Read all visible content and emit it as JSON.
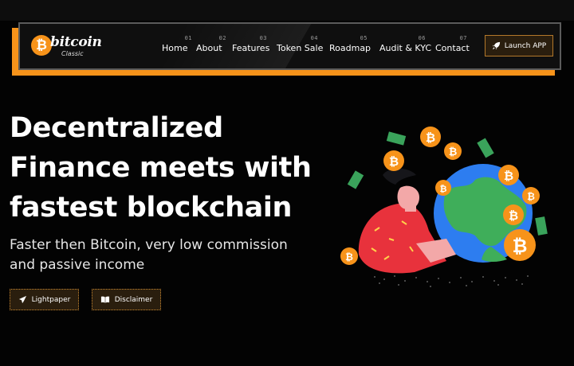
{
  "brand": {
    "name": "bitcoin",
    "sub": "Classic",
    "coin_symbol": "₿",
    "color": "#f7931a"
  },
  "nav": {
    "items": [
      {
        "num": "01",
        "label": "Home"
      },
      {
        "num": "02",
        "label": "About"
      },
      {
        "num": "03",
        "label": "Features"
      },
      {
        "num": "04",
        "label": "Token Sale"
      },
      {
        "num": "05",
        "label": "Roadmap"
      },
      {
        "num": "06",
        "label": "Audit & KYC"
      },
      {
        "num": "07",
        "label": "Contact"
      }
    ],
    "launch_label": "Launch APP",
    "launch_icon": "rocket-icon"
  },
  "hero": {
    "headline_lines": [
      "Decentralized",
      "Finance meets with",
      "fastest blockchain"
    ],
    "sub_lines": [
      "Faster then Bitcoin, very low commission",
      "and passive income"
    ],
    "buttons": {
      "lightpaper": {
        "label": "Lightpaper",
        "icon": "paper-plane-icon"
      },
      "disclaimer": {
        "label": "Disclaimer",
        "icon": "book-icon"
      }
    }
  },
  "colors": {
    "background": "#030303",
    "accent": "#f7931a",
    "button_bg": "#2a1e0e"
  }
}
